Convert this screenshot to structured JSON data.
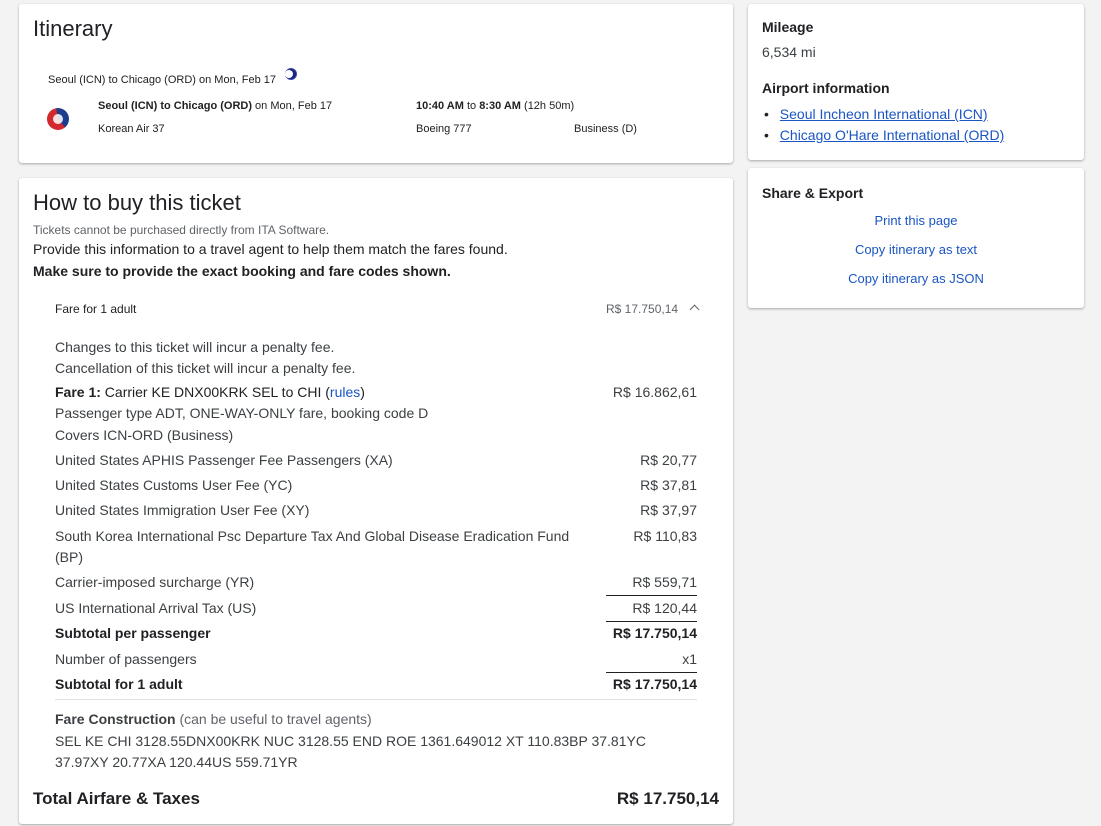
{
  "itinerary": {
    "title": "Itinerary",
    "summary_route": "Seoul (ICN) to Chicago (ORD)",
    "summary_date": " on Mon, Feb 17",
    "segment": {
      "route": "Seoul (ICN) to Chicago (ORD)",
      "date": " on Mon, Feb 17",
      "carrier": "Korean Air 37",
      "depart": "10:40 AM",
      "to_word": " to ",
      "arrive": "8:30 AM",
      "duration": " (12h 50m)",
      "aircraft": "Boeing 777",
      "cabin": "Business (D)"
    }
  },
  "buy": {
    "title": "How to buy this ticket",
    "note": "Tickets cannot be purchased directly from ITA Software.",
    "instruction": "Provide this information to a travel agent to help them match the fares found.",
    "emphasis": "Make sure to provide the exact booking and fare codes shown.",
    "fare_header": "Fare for 1 adult",
    "fare_header_amount": "R$ 17.750,14",
    "change_penalty": "Changes to this ticket will incur a penalty fee.",
    "cancel_penalty": "Cancellation of this ticket will incur a penalty fee.",
    "fare1_label": "Fare 1:",
    "fare1_text": " Carrier KE DNX00KRK SEL to CHI (",
    "fare1_link": "rules",
    "fare1_close": ")",
    "fare1_amount": "R$ 16.862,61",
    "fare1_detail1": "Passenger type ADT, ONE-WAY-ONLY fare, booking code D",
    "fare1_detail2": "Covers ICN-ORD (Business)",
    "taxes": [
      {
        "label": "United States APHIS Passenger Fee Passengers (XA)",
        "amount": "R$ 20,77"
      },
      {
        "label": "United States Customs User Fee (YC)",
        "amount": "R$ 37,81"
      },
      {
        "label": "United States Immigration User Fee (XY)",
        "amount": "R$ 37,97"
      },
      {
        "label": "South Korea International Psc Departure Tax And Global Disease Eradication Fund",
        "label2": "(BP)",
        "amount": "R$ 110,83"
      },
      {
        "label": "Carrier-imposed surcharge (YR)",
        "amount": "R$ 559,71"
      },
      {
        "label": "US International Arrival Tax (US)",
        "amount": "R$ 120,44"
      }
    ],
    "subtotal_pp_label": "Subtotal per passenger",
    "subtotal_pp_amount": "R$ 17.750,14",
    "num_pass_label": "Number of passengers",
    "num_pass_value": "x1",
    "subtotal_label": "Subtotal for 1 adult",
    "subtotal_amount": "R$ 17.750,14",
    "fc_label": "Fare Construction",
    "fc_note": " (can be useful to travel agents)",
    "fc_line1": "SEL KE CHI 3128.55DNX00KRK NUC 3128.55 END ROE 1361.649012 XT 110.83BP 37.81YC",
    "fc_line2": "37.97XY 20.77XA 120.44US 559.71YR",
    "total_label": "Total Airfare & Taxes",
    "total_amount": "R$ 17.750,14"
  },
  "mileage": {
    "title": "Mileage",
    "value": "6,534 mi",
    "airport_title": "Airport information",
    "airports": [
      "Seoul Incheon International (ICN)",
      "Chicago O'Hare International (ORD)"
    ]
  },
  "share": {
    "title": "Share & Export",
    "print": "Print this page",
    "copy_text": "Copy itinerary as text",
    "copy_json": "Copy itinerary as JSON"
  },
  "colors": {
    "link": "#1a55c4",
    "logo_red": "#d4282f",
    "logo_blue": "#1c3c8c"
  },
  "icons": [
    "korean-air-logo-icon",
    "overnight-moon-icon",
    "chevron-up-icon"
  ]
}
